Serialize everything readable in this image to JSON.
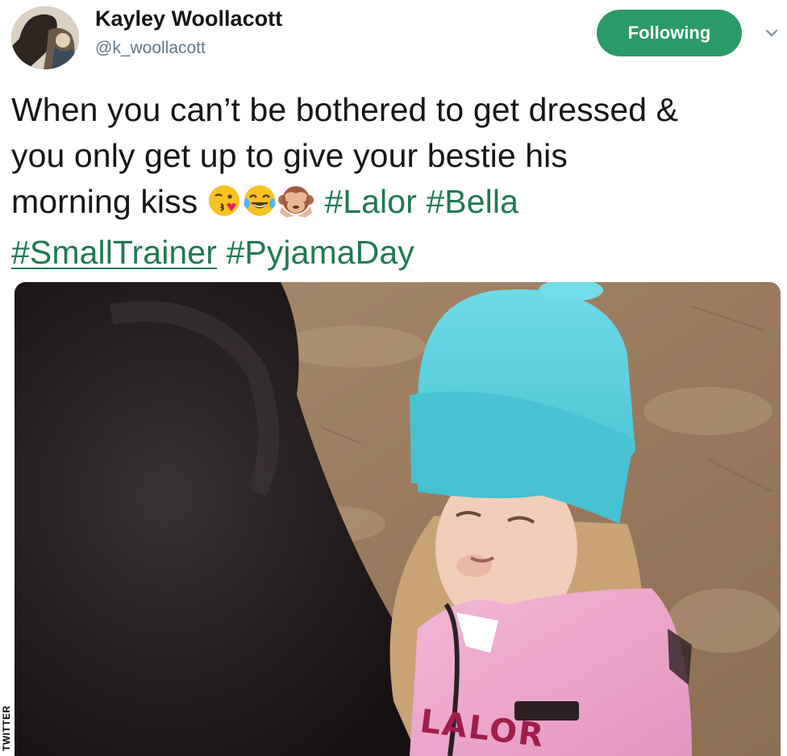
{
  "author": {
    "name": "Kayley Woollacott",
    "handle": "@k_woollacott",
    "avatar_icon": "avatar-horse-photo"
  },
  "follow_button": {
    "label": "Following",
    "color": "#2a9a68"
  },
  "menu_caret": {
    "icon": "chevron-down-icon"
  },
  "tweet": {
    "line1": "When you can’t be bothered to get dressed &",
    "line2": "you only get up to give your bestie his",
    "line3_text": "morning kiss",
    "emojis": [
      "face-blowing-kiss",
      "face-with-tears-of-joy",
      "see-no-evil-monkey"
    ],
    "hashtags": [
      "#Lalor",
      "#Bella",
      "#SmallTrainer",
      "#PyjamaDay"
    ],
    "hashtag_color": "#1d7a52"
  },
  "media": {
    "hat_text": "LALOR",
    "hat_color": "#5ad0de"
  },
  "watermark": "TWITTER"
}
